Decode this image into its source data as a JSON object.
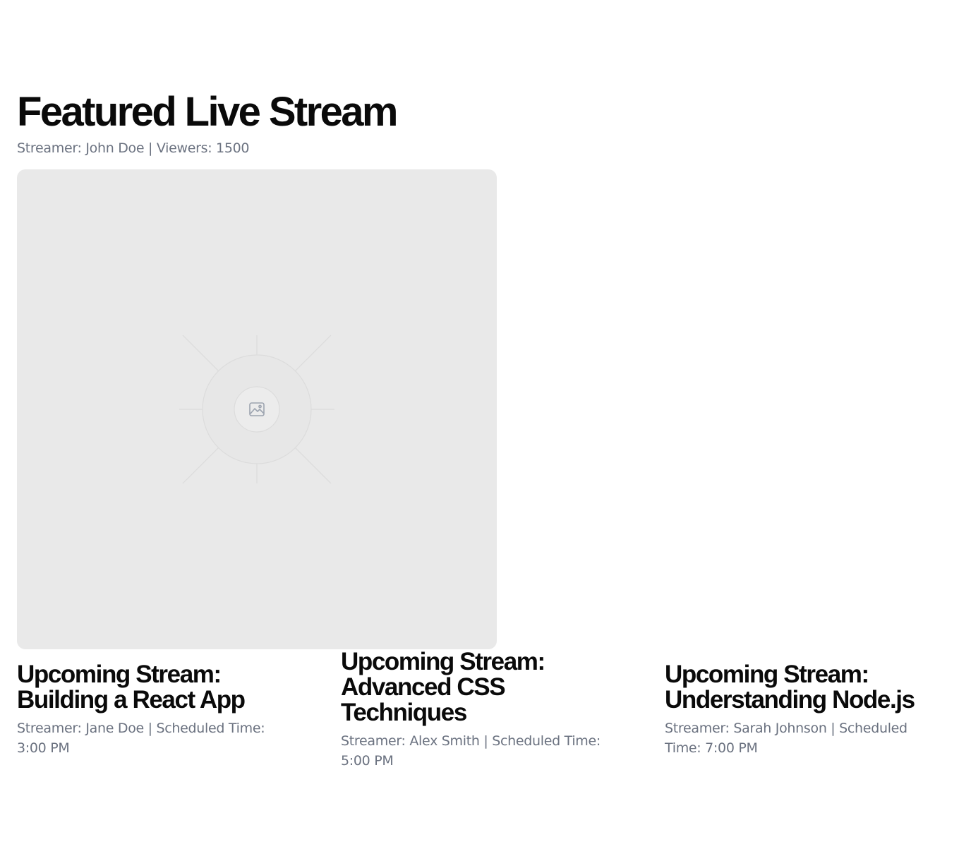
{
  "featured": {
    "title": "Featured Live Stream",
    "meta": "Streamer: John Doe | Viewers: 1500",
    "video_icon": "image-placeholder-icon"
  },
  "upcoming": [
    {
      "title": "Upcoming Stream: Building a React App",
      "meta": "Streamer: Jane Doe | Scheduled Time: 3:00 PM"
    },
    {
      "title": "Upcoming Stream: Advanced CSS Techniques",
      "meta": "Streamer: Alex Smith | Scheduled Time: 5:00 PM"
    },
    {
      "title": "Upcoming Stream: Understanding Node.js",
      "meta": "Streamer: Sarah Johnson | Scheduled Time: 7:00 PM"
    }
  ],
  "colors": {
    "heading": "#0a0a0a",
    "meta_text": "#6b7280",
    "placeholder_bg": "#e9e9e9"
  }
}
